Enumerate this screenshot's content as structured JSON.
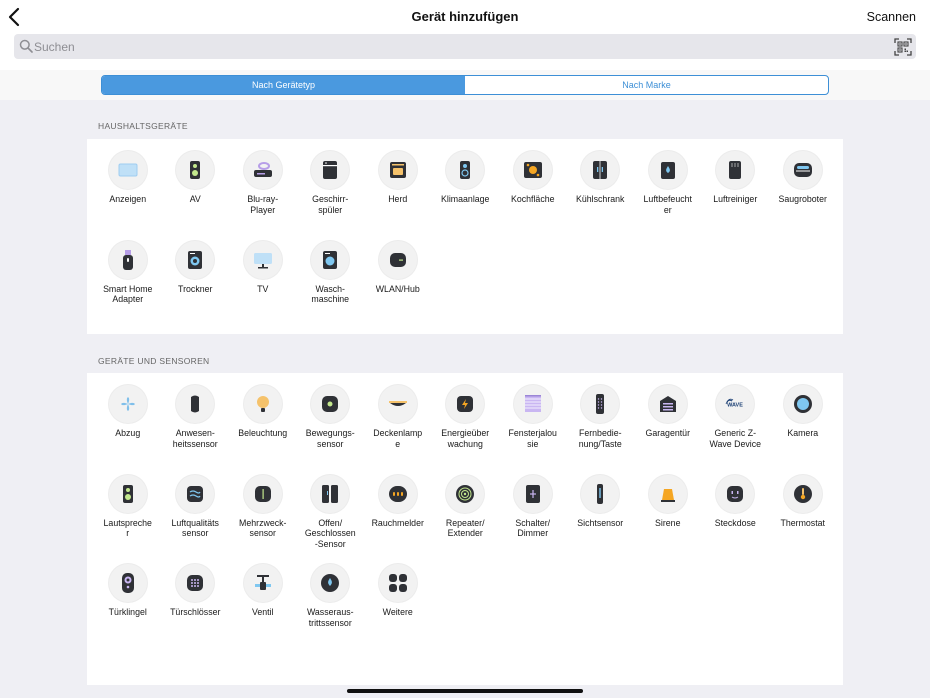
{
  "header": {
    "title": "Gerät hinzufügen",
    "scan_label": "Scannen"
  },
  "search": {
    "placeholder": "Suchen"
  },
  "segments": [
    {
      "label": "Nach Gerätetyp",
      "active": true
    },
    {
      "label": "Nach Marke",
      "active": false
    }
  ],
  "sections": [
    {
      "title": "HAUSHALTSGERÄTE",
      "items": [
        {
          "label": "Anzeigen",
          "icon": "display-icon"
        },
        {
          "label": "AV",
          "icon": "speaker-icon"
        },
        {
          "label": "Blu-ray-\nPlayer",
          "icon": "bluray-player-icon"
        },
        {
          "label": "Geschirr-\nspüler",
          "icon": "dishwasher-icon"
        },
        {
          "label": "Herd",
          "icon": "stove-icon"
        },
        {
          "label": "Klimaanlage",
          "icon": "air-conditioner-icon"
        },
        {
          "label": "Kochfläche",
          "icon": "cooktop-icon"
        },
        {
          "label": "Kühlschrank",
          "icon": "fridge-icon"
        },
        {
          "label": "Luftbefeucht\ner",
          "icon": "humidifier-icon"
        },
        {
          "label": "Luftreiniger",
          "icon": "air-purifier-icon"
        },
        {
          "label": "Saugroboter",
          "icon": "robot-vacuum-icon"
        },
        {
          "label": "Smart Home\nAdapter",
          "icon": "usb-adapter-icon"
        },
        {
          "label": "Trockner",
          "icon": "dryer-icon"
        },
        {
          "label": "TV",
          "icon": "tv-icon"
        },
        {
          "label": "Wasch-\nmaschine",
          "icon": "washing-machine-icon"
        },
        {
          "label": "WLAN/Hub",
          "icon": "hub-icon"
        }
      ]
    },
    {
      "title": "GERÄTE UND SENSOREN",
      "items": [
        {
          "label": "Abzug",
          "icon": "fan-icon"
        },
        {
          "label": "Anwesen-\nheitssensor",
          "icon": "presence-sensor-icon"
        },
        {
          "label": "Beleuchtung",
          "icon": "bulb-icon"
        },
        {
          "label": "Bewegungs-\nsensor",
          "icon": "motion-sensor-icon"
        },
        {
          "label": "Deckenlamp\ne",
          "icon": "ceiling-lamp-icon"
        },
        {
          "label": "Energieüber\nwachung",
          "icon": "energy-monitor-icon"
        },
        {
          "label": "Fensterjalou\nsie",
          "icon": "blinds-icon"
        },
        {
          "label": "Fernbedie-\nnung/Taste",
          "icon": "remote-icon"
        },
        {
          "label": "Garagentür",
          "icon": "garage-door-icon"
        },
        {
          "label": "Generic Z-\nWave Device",
          "icon": "zwave-icon"
        },
        {
          "label": "Kamera",
          "icon": "camera-icon"
        },
        {
          "label": "Lautspreche\nr",
          "icon": "loudspeaker-icon"
        },
        {
          "label": "Luftqualitäts\nsensor",
          "icon": "air-quality-icon"
        },
        {
          "label": "Mehrzweck-\nsensor",
          "icon": "multi-sensor-icon"
        },
        {
          "label": "Offen/\nGeschlossen\n-Sensor",
          "icon": "contact-sensor-icon"
        },
        {
          "label": "Rauchmelder",
          "icon": "smoke-detector-icon"
        },
        {
          "label": "Repeater/\nExtender",
          "icon": "repeater-icon"
        },
        {
          "label": "Schalter/\nDimmer",
          "icon": "switch-icon"
        },
        {
          "label": "Sichtsensor",
          "icon": "vision-sensor-icon"
        },
        {
          "label": "Sirene",
          "icon": "siren-icon"
        },
        {
          "label": "Steckdose",
          "icon": "outlet-icon"
        },
        {
          "label": "Thermostat",
          "icon": "thermostat-icon"
        },
        {
          "label": "Türklingel",
          "icon": "doorbell-icon"
        },
        {
          "label": "Türschlösser",
          "icon": "door-lock-icon"
        },
        {
          "label": "Ventil",
          "icon": "valve-icon"
        },
        {
          "label": "Wasseraus-\ntrittssensor",
          "icon": "water-leak-icon"
        },
        {
          "label": "Weitere",
          "icon": "more-icon"
        }
      ]
    }
  ],
  "colors": {
    "accent": "#4a99df",
    "dark_device": "#2f3136",
    "highlight_green": "#c3e88d",
    "highlight_blue": "#7fc7f0",
    "highlight_orange": "#f5a623",
    "lavender": "#c9b6f2"
  }
}
